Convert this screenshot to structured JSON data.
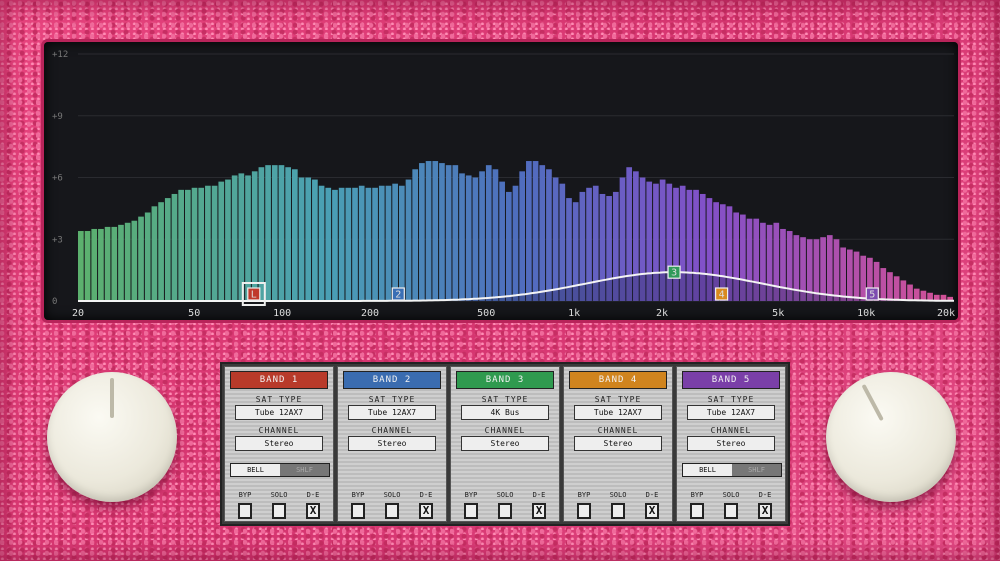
{
  "spectrum": {
    "db_labels": [
      "+12",
      "+9",
      "+6",
      "+3",
      "0"
    ],
    "freq_labels": [
      "20",
      "50",
      "100",
      "200",
      "500",
      "1k",
      "2k",
      "5k",
      "10k",
      "20k"
    ],
    "bars": [
      3.4,
      3.4,
      3.5,
      3.5,
      3.6,
      3.6,
      3.7,
      3.8,
      3.9,
      4.1,
      4.3,
      4.6,
      4.8,
      5.0,
      5.2,
      5.4,
      5.4,
      5.5,
      5.5,
      5.6,
      5.6,
      5.8,
      5.9,
      6.1,
      6.2,
      6.1,
      6.3,
      6.5,
      6.6,
      6.6,
      6.6,
      6.5,
      6.4,
      6.0,
      6.0,
      5.9,
      5.6,
      5.5,
      5.4,
      5.5,
      5.5,
      5.5,
      5.6,
      5.5,
      5.5,
      5.6,
      5.6,
      5.7,
      5.6,
      5.9,
      6.4,
      6.7,
      6.8,
      6.8,
      6.7,
      6.6,
      6.6,
      6.2,
      6.1,
      6.0,
      6.3,
      6.6,
      6.4,
      5.8,
      5.3,
      5.6,
      6.3,
      6.8,
      6.8,
      6.6,
      6.4,
      6.0,
      5.7,
      5.0,
      4.8,
      5.3,
      5.5,
      5.6,
      5.2,
      5.1,
      5.3,
      6.0,
      6.5,
      6.3,
      6.0,
      5.8,
      5.7,
      5.9,
      5.7,
      5.5,
      5.6,
      5.4,
      5.4,
      5.2,
      5.0,
      4.8,
      4.7,
      4.6,
      4.3,
      4.2,
      4.0,
      4.0,
      3.8,
      3.7,
      3.8,
      3.5,
      3.4,
      3.2,
      3.1,
      3.0,
      3.0,
      3.1,
      3.2,
      3.0,
      2.6,
      2.5,
      2.4,
      2.2,
      2.1,
      1.9,
      1.6,
      1.4,
      1.2,
      1.0,
      0.8,
      0.6,
      0.5,
      0.4,
      0.3,
      0.3,
      0.2
    ],
    "band_nodes": [
      {
        "label": "L",
        "freq_hz": 80,
        "gain_db": 0,
        "color": "#c0392b",
        "selected": true
      },
      {
        "label": "2",
        "freq_hz": 250,
        "gain_db": 0,
        "color": "#3a6fb5",
        "selected": false
      },
      {
        "label": "3",
        "freq_hz": 2200,
        "gain_db": 1.4,
        "color": "#2f9a5a",
        "selected": false
      },
      {
        "label": "4",
        "freq_hz": 3200,
        "gain_db": 0,
        "color": "#d98a1e",
        "selected": false
      },
      {
        "label": "5",
        "freq_hz": 10500,
        "gain_db": 0,
        "color": "#7d4bb0",
        "selected": false
      }
    ]
  },
  "bands": [
    {
      "name": "BAND 1",
      "color": "#b83a2a",
      "sat_type_label": "SAT TYPE",
      "sat_type": "Tube 12AX7",
      "channel_label": "CHANNEL",
      "channel": "Stereo",
      "toggle": [
        "BELL",
        "SHLF"
      ],
      "bypass_label": "BYP",
      "solo_label": "SOLO",
      "de_label": "D-E",
      "checks": [
        "",
        "",
        "X"
      ]
    },
    {
      "name": "BAND 2",
      "color": "#3a6cb0",
      "sat_type_label": "SAT TYPE",
      "sat_type": "Tube 12AX7",
      "channel_label": "CHANNEL",
      "channel": "Stereo",
      "toggle": null,
      "bypass_label": "BYP",
      "solo_label": "SOLO",
      "de_label": "D-E",
      "checks": [
        "",
        "",
        "X"
      ]
    },
    {
      "name": "BAND 3",
      "color": "#2f9a4f",
      "sat_type_label": "SAT TYPE",
      "sat_type": "4K Bus",
      "channel_label": "CHANNEL",
      "channel": "Stereo",
      "toggle": null,
      "bypass_label": "BYP",
      "solo_label": "SOLO",
      "de_label": "D-E",
      "checks": [
        "",
        "",
        "X"
      ]
    },
    {
      "name": "BAND 4",
      "color": "#d0841e",
      "sat_type_label": "SAT TYPE",
      "sat_type": "Tube 12AX7",
      "channel_label": "CHANNEL",
      "channel": "Stereo",
      "toggle": null,
      "bypass_label": "BYP",
      "solo_label": "SOLO",
      "de_label": "D-E",
      "checks": [
        "",
        "",
        "X"
      ]
    },
    {
      "name": "BAND 5",
      "color": "#7a3fa8",
      "sat_type_label": "SAT TYPE",
      "sat_type": "Tube 12AX7",
      "channel_label": "CHANNEL",
      "channel": "Stereo",
      "toggle": [
        "BELL",
        "SHLF"
      ],
      "bypass_label": "BYP",
      "solo_label": "SOLO",
      "de_label": "D-E",
      "checks": [
        "",
        "",
        "X"
      ]
    }
  ]
}
